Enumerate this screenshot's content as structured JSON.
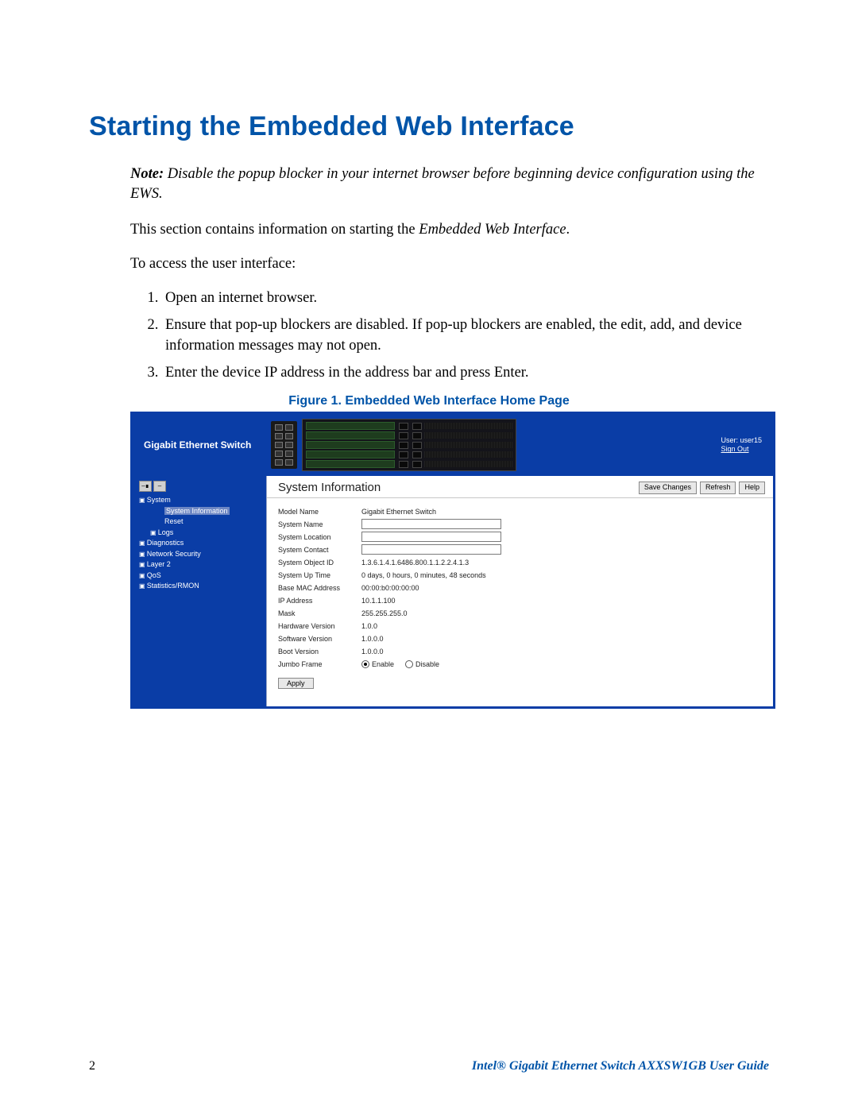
{
  "heading": "Starting the Embedded Web Interface",
  "note": {
    "label": "Note:",
    "text": "Disable the popup blocker in your internet browser before beginning device configuration using the EWS."
  },
  "intro_pre": "This section contains information on starting the ",
  "intro_ital": "Embedded Web Interface",
  "intro_post": ".",
  "access_line": "To access the user interface:",
  "steps": [
    "Open an internet browser.",
    "Ensure that pop-up blockers are disabled. If pop-up blockers are enabled, the edit, add, and device information messages may not open.",
    "Enter the device IP address in the address bar and press Enter."
  ],
  "figure_caption": "Figure 1. Embedded Web Interface Home Page",
  "ews": {
    "brand": "Gigabit Ethernet Switch",
    "user_line": "User: user15",
    "signout": "Sign Out",
    "buttons": {
      "save": "Save Changes",
      "refresh": "Refresh",
      "help": "Help"
    },
    "panel_title": "System Information",
    "nav": {
      "root": "System",
      "children": [
        "System Information",
        "Reset",
        "Logs"
      ],
      "siblings": [
        "Diagnostics",
        "Network Security",
        "Layer 2",
        "QoS",
        "Statistics/RMON"
      ]
    },
    "rows": {
      "model_name_k": "Model Name",
      "model_name_v": "Gigabit Ethernet Switch",
      "system_name_k": "System Name",
      "system_location_k": "System Location",
      "system_contact_k": "System Contact",
      "sys_obj_k": "System Object ID",
      "sys_obj_v": "1.3.6.1.4.1.6486.800.1.1.2.2.4.1.3",
      "uptime_k": "System Up Time",
      "uptime_v": "0 days, 0 hours, 0 minutes, 48 seconds",
      "mac_k": "Base MAC Address",
      "mac_v": "00:00:b0:00:00:00",
      "ip_k": "IP Address",
      "ip_v": "10.1.1.100",
      "mask_k": "Mask",
      "mask_v": "255.255.255.0",
      "hw_k": "Hardware Version",
      "hw_v": "1.0.0",
      "sw_k": "Software Version",
      "sw_v": "1.0.0.0",
      "boot_k": "Boot Version",
      "boot_v": "1.0.0.0",
      "jumbo_k": "Jumbo Frame",
      "jumbo_en": "Enable",
      "jumbo_dis": "Disable",
      "apply": "Apply"
    }
  },
  "footer": {
    "page": "2",
    "guide": "Intel® Gigabit Ethernet Switch AXXSW1GB User Guide"
  }
}
